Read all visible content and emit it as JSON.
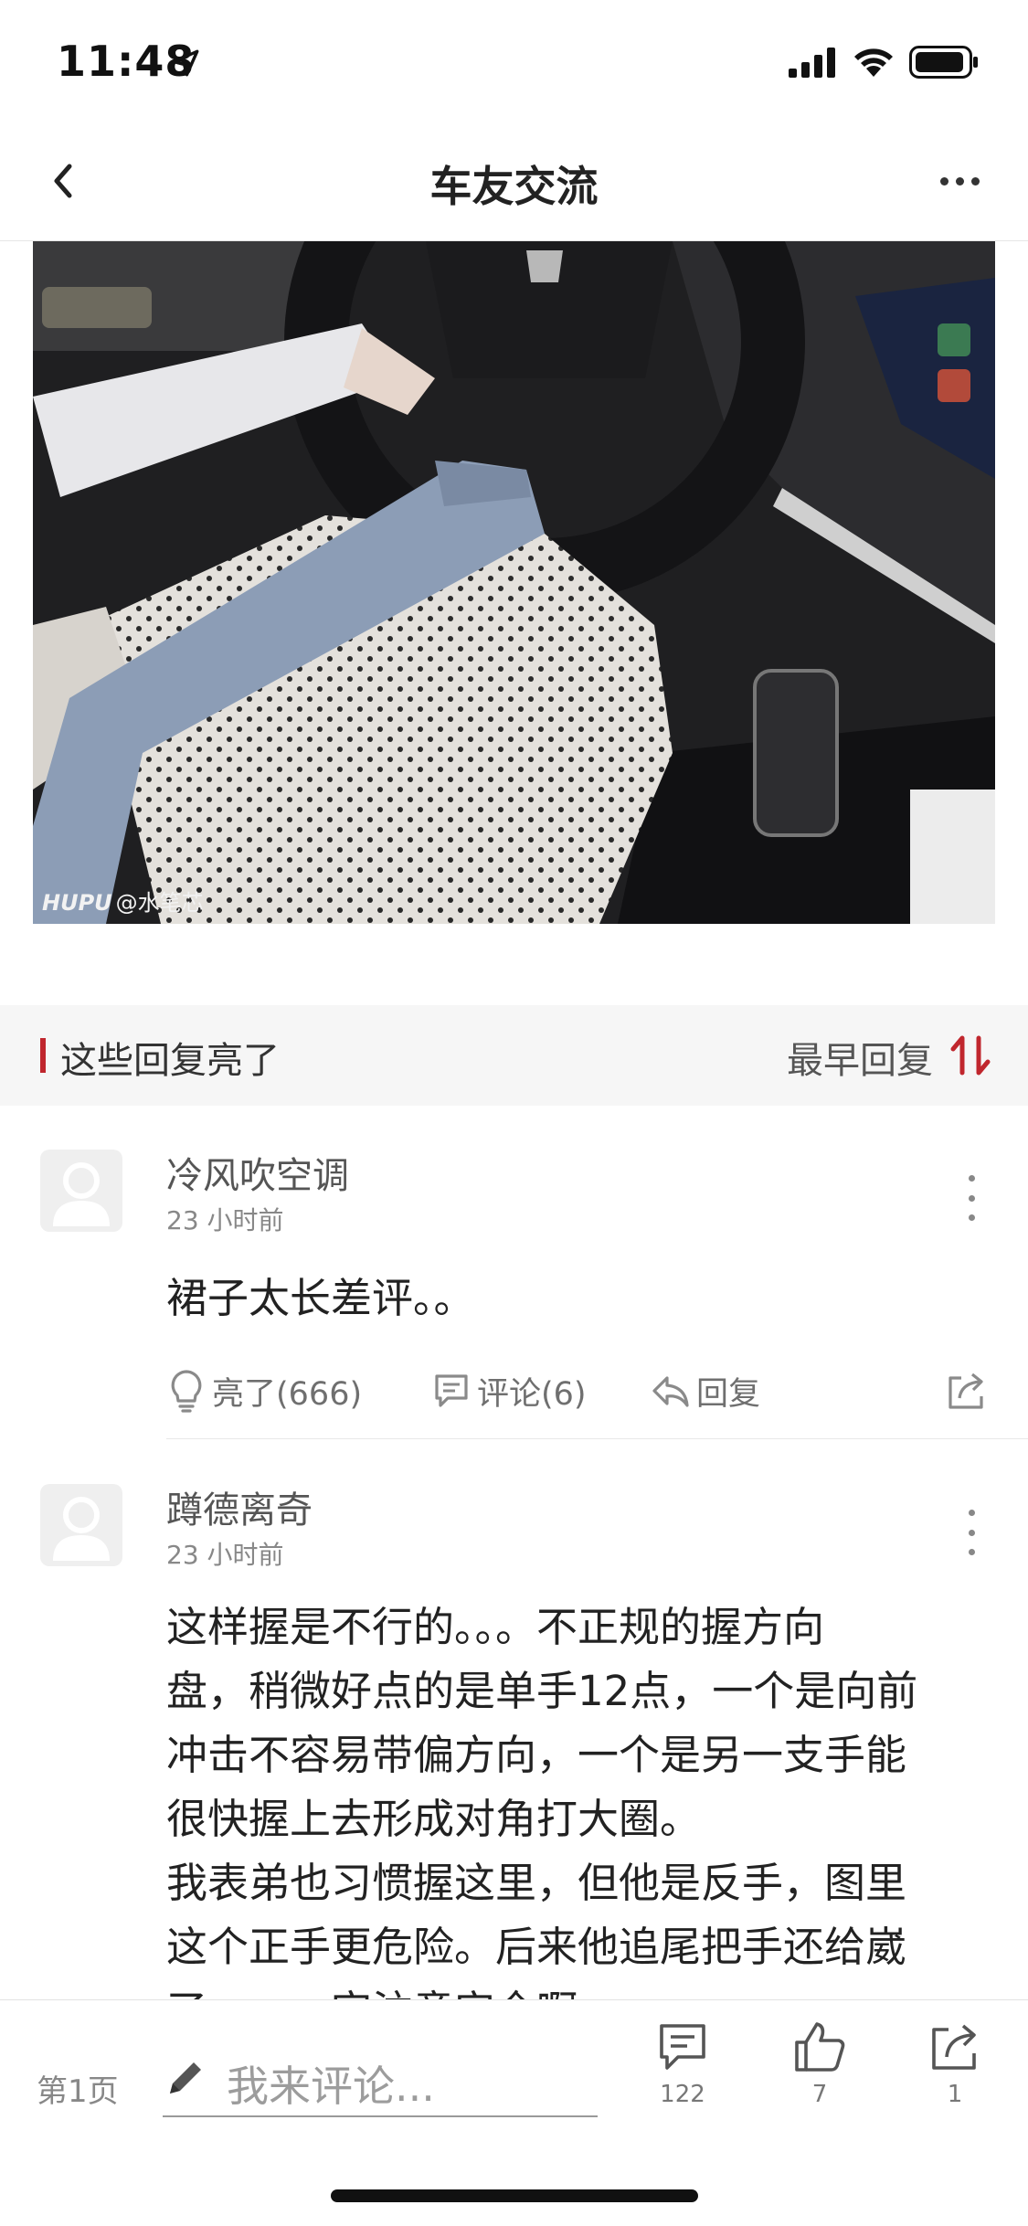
{
  "status_bar": {
    "time": "11:48"
  },
  "nav": {
    "title": "车友交流"
  },
  "photo": {
    "watermark_brand": "HUPU",
    "watermark_user": "@水笔芯"
  },
  "section": {
    "title": "这些回复亮了",
    "sort_label": "最早回复"
  },
  "comments": [
    {
      "username": "冷风吹空调",
      "time": "23 小时前",
      "body": "裙子太长差评。。",
      "actions": {
        "light": "亮了(666)",
        "comment": "评论(6)",
        "reply": "回复"
      }
    },
    {
      "username": "蹲德离奇",
      "time": "23 小时前",
      "body_lines": [
        "这样握是不行的。。。不正规的握方向",
        "盘，稍微好点的是单手12点，一个是向前",
        "冲击不容易带偏方向，一个是另一支手能",
        "很快握上去形成对角打大圈。",
        "我表弟也习惯握这里，但他是反手，图里",
        "这个正手更危险。后来他追尾把手还给崴",
        "了……一定注意安全啊"
      ]
    }
  ],
  "bottom_bar": {
    "page": "第1页",
    "input_placeholder": "我来评论...",
    "comments_count": "122",
    "likes_count": "7",
    "shares_count": "1"
  },
  "colors": {
    "accent": "#c0262d",
    "text": "#222222",
    "muted": "#888888"
  }
}
